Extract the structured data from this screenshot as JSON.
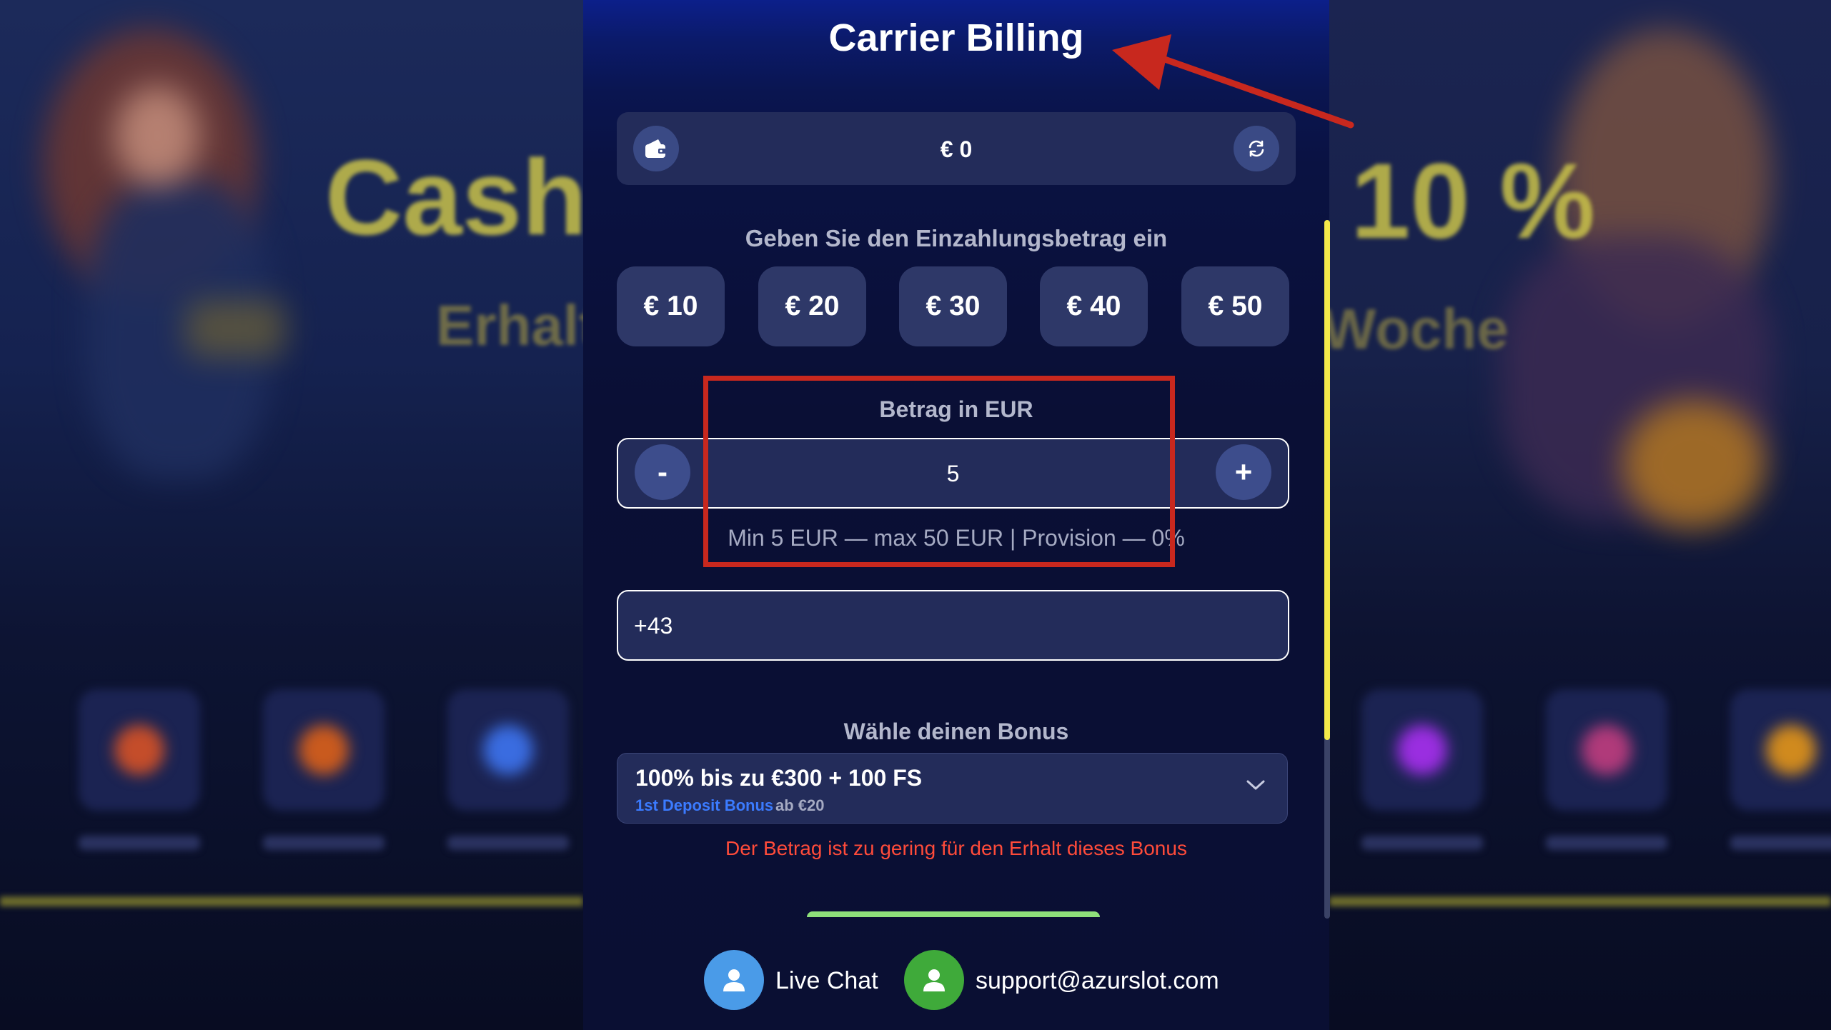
{
  "modal": {
    "title": "Carrier Billing",
    "balance": {
      "value": "€ 0",
      "wallet_icon": "wallet-icon",
      "refresh_icon": "refresh-icon"
    },
    "amount_prompt": "Geben Sie den Einzahlungsbetrag ein",
    "preset_amounts": [
      "€ 10",
      "€ 20",
      "€ 30",
      "€ 40",
      "€ 50"
    ],
    "amount_field": {
      "label": "Betrag in EUR",
      "decrement_label": "-",
      "increment_label": "+",
      "value": "5",
      "limits_hint": "Min 5 EUR — max 50 EUR | Provision — 0%"
    },
    "phone_field": {
      "value": "+43"
    },
    "bonus": {
      "label": "Wähle deinen Bonus",
      "selected_title": "100% bis zu €300 + 100 FS",
      "selected_tag": "1st Deposit Bonus",
      "selected_min": "ab €20",
      "error": "Der Betrag ist zu gering für den Erhalt dieses Bonus"
    },
    "footer": {
      "live_chat": "Live Chat",
      "support_email": "support@azurslot.com"
    }
  },
  "background": {
    "promo_left_title": "Cash",
    "promo_left_sub": "Erhalt",
    "promo_right_title": "10 %",
    "promo_right_sub": "Woche"
  },
  "colors": {
    "highlight_red": "#c8281e",
    "scroll_yellow": "#f4e94a",
    "error_red": "#ff4b3a",
    "live_chat_blue": "#4a9be8",
    "support_green": "#3faa3a",
    "bonus_tag_blue": "#3b7bff"
  }
}
